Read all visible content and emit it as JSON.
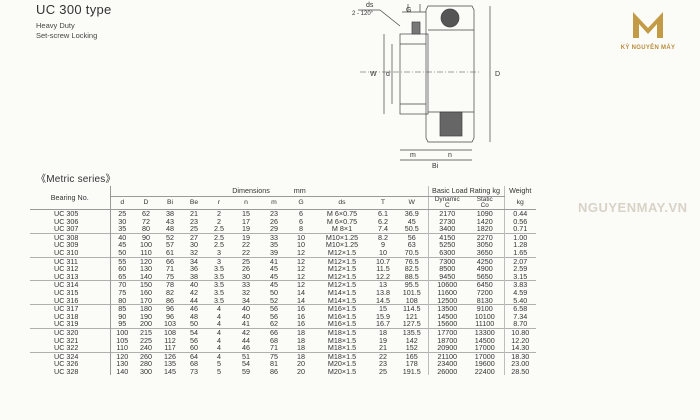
{
  "header": {
    "title": "UC 300 type",
    "subtitle_1": "Heavy Duty",
    "subtitle_2": "Set-screw Locking"
  },
  "drawing": {
    "labels": {
      "ds": "ds",
      "thread": "2 - 120°",
      "G": "G",
      "W": "W",
      "d": "d",
      "D": "D",
      "m": "m",
      "n": "n",
      "Bi": "Bi"
    }
  },
  "logo": {
    "brand": "KỲ NGUYÊN MÁY",
    "watermark": "NGUYENMAY.VN"
  },
  "table": {
    "section_title": "《Metric series》",
    "header": {
      "bearing_no": "Bearing No.",
      "dimensions": "Dimensions",
      "unit_mm": "mm",
      "basic_load": "Basic Load",
      "rating_kg": "Rating kg",
      "weight": "Weight",
      "kg": "kg",
      "cols": [
        "d",
        "D",
        "Bi",
        "Be",
        "r",
        "n",
        "m",
        "G",
        "ds",
        "T",
        "W"
      ],
      "dynamic_1": "Dynamic",
      "dynamic_2": "C",
      "static_1": "Static",
      "static_2": "Co"
    },
    "groups": [
      [
        [
          "UC 305",
          "25",
          "62",
          "38",
          "21",
          "2",
          "15",
          "23",
          "6",
          "M 6×0.75",
          "6.1",
          "36.9",
          "2170",
          "1090",
          "0.44"
        ],
        [
          "UC 306",
          "30",
          "72",
          "43",
          "23",
          "2",
          "17",
          "26",
          "6",
          "M 6×0.75",
          "6.2",
          "45",
          "2730",
          "1420",
          "0.56"
        ],
        [
          "UC 307",
          "35",
          "80",
          "48",
          "25",
          "2.5",
          "19",
          "29",
          "8",
          "M 8×1",
          "7.4",
          "50.5",
          "3400",
          "1820",
          "0.71"
        ]
      ],
      [
        [
          "UC 308",
          "40",
          "90",
          "52",
          "27",
          "2.5",
          "19",
          "33",
          "10",
          "M10×1.25",
          "8.2",
          "56",
          "4150",
          "2270",
          "1.00"
        ],
        [
          "UC 309",
          "45",
          "100",
          "57",
          "30",
          "2.5",
          "22",
          "35",
          "10",
          "M10×1.25",
          "9",
          "63",
          "5250",
          "3050",
          "1.28"
        ],
        [
          "UC 310",
          "50",
          "110",
          "61",
          "32",
          "3",
          "22",
          "39",
          "12",
          "M12×1.5",
          "10",
          "70.5",
          "6300",
          "3650",
          "1.65"
        ]
      ],
      [
        [
          "UC 311",
          "55",
          "120",
          "66",
          "34",
          "3",
          "25",
          "41",
          "12",
          "M12×1.5",
          "10.7",
          "76.5",
          "7300",
          "4250",
          "2.07"
        ],
        [
          "UC 312",
          "60",
          "130",
          "71",
          "36",
          "3.5",
          "26",
          "45",
          "12",
          "M12×1.5",
          "11.5",
          "82.5",
          "8500",
          "4900",
          "2.59"
        ],
        [
          "UC 313",
          "65",
          "140",
          "75",
          "38",
          "3.5",
          "30",
          "45",
          "12",
          "M12×1.5",
          "12.2",
          "88.5",
          "9450",
          "5650",
          "3.15"
        ]
      ],
      [
        [
          "UC 314",
          "70",
          "150",
          "78",
          "40",
          "3.5",
          "33",
          "45",
          "12",
          "M12×1.5",
          "13",
          "95.5",
          "10600",
          "6450",
          "3.83"
        ],
        [
          "UC 315",
          "75",
          "160",
          "82",
          "42",
          "3.5",
          "32",
          "50",
          "14",
          "M14×1.5",
          "13.8",
          "101.5",
          "11600",
          "7200",
          "4.59"
        ],
        [
          "UC 316",
          "80",
          "170",
          "86",
          "44",
          "3.5",
          "34",
          "52",
          "14",
          "M14×1.5",
          "14.5",
          "108",
          "12500",
          "8130",
          "5.40"
        ]
      ],
      [
        [
          "UC 317",
          "85",
          "180",
          "96",
          "46",
          "4",
          "40",
          "56",
          "16",
          "M16×1.5",
          "15",
          "114.5",
          "13500",
          "9100",
          "6.58"
        ],
        [
          "UC 318",
          "90",
          "190",
          "96",
          "48",
          "4",
          "40",
          "56",
          "16",
          "M16×1.5",
          "15.9",
          "121",
          "14500",
          "10100",
          "7.34"
        ],
        [
          "UC 319",
          "95",
          "200",
          "103",
          "50",
          "4",
          "41",
          "62",
          "16",
          "M16×1.5",
          "16.7",
          "127.5",
          "15600",
          "11100",
          "8.70"
        ]
      ],
      [
        [
          "UC 320",
          "100",
          "215",
          "108",
          "54",
          "4",
          "42",
          "66",
          "18",
          "M18×1.5",
          "18",
          "135.5",
          "17700",
          "13300",
          "10.80"
        ],
        [
          "UC 321",
          "105",
          "225",
          "112",
          "56",
          "4",
          "44",
          "68",
          "18",
          "M18×1.5",
          "19",
          "142",
          "18700",
          "14500",
          "12.20"
        ],
        [
          "UC 322",
          "110",
          "240",
          "117",
          "60",
          "4",
          "46",
          "71",
          "18",
          "M18×1.5",
          "21",
          "152",
          "20900",
          "17000",
          "14.30"
        ]
      ],
      [
        [
          "UC 324",
          "120",
          "260",
          "126",
          "64",
          "4",
          "51",
          "75",
          "18",
          "M18×1.5",
          "22",
          "165",
          "21100",
          "17000",
          "18.30"
        ],
        [
          "UC 326",
          "130",
          "280",
          "135",
          "68",
          "5",
          "54",
          "81",
          "20",
          "M20×1.5",
          "23",
          "178",
          "23400",
          "19600",
          "23.00"
        ],
        [
          "UC 328",
          "140",
          "300",
          "145",
          "73",
          "5",
          "59",
          "86",
          "20",
          "M20×1.5",
          "25",
          "191.5",
          "26000",
          "22400",
          "28.50"
        ]
      ]
    ]
  }
}
